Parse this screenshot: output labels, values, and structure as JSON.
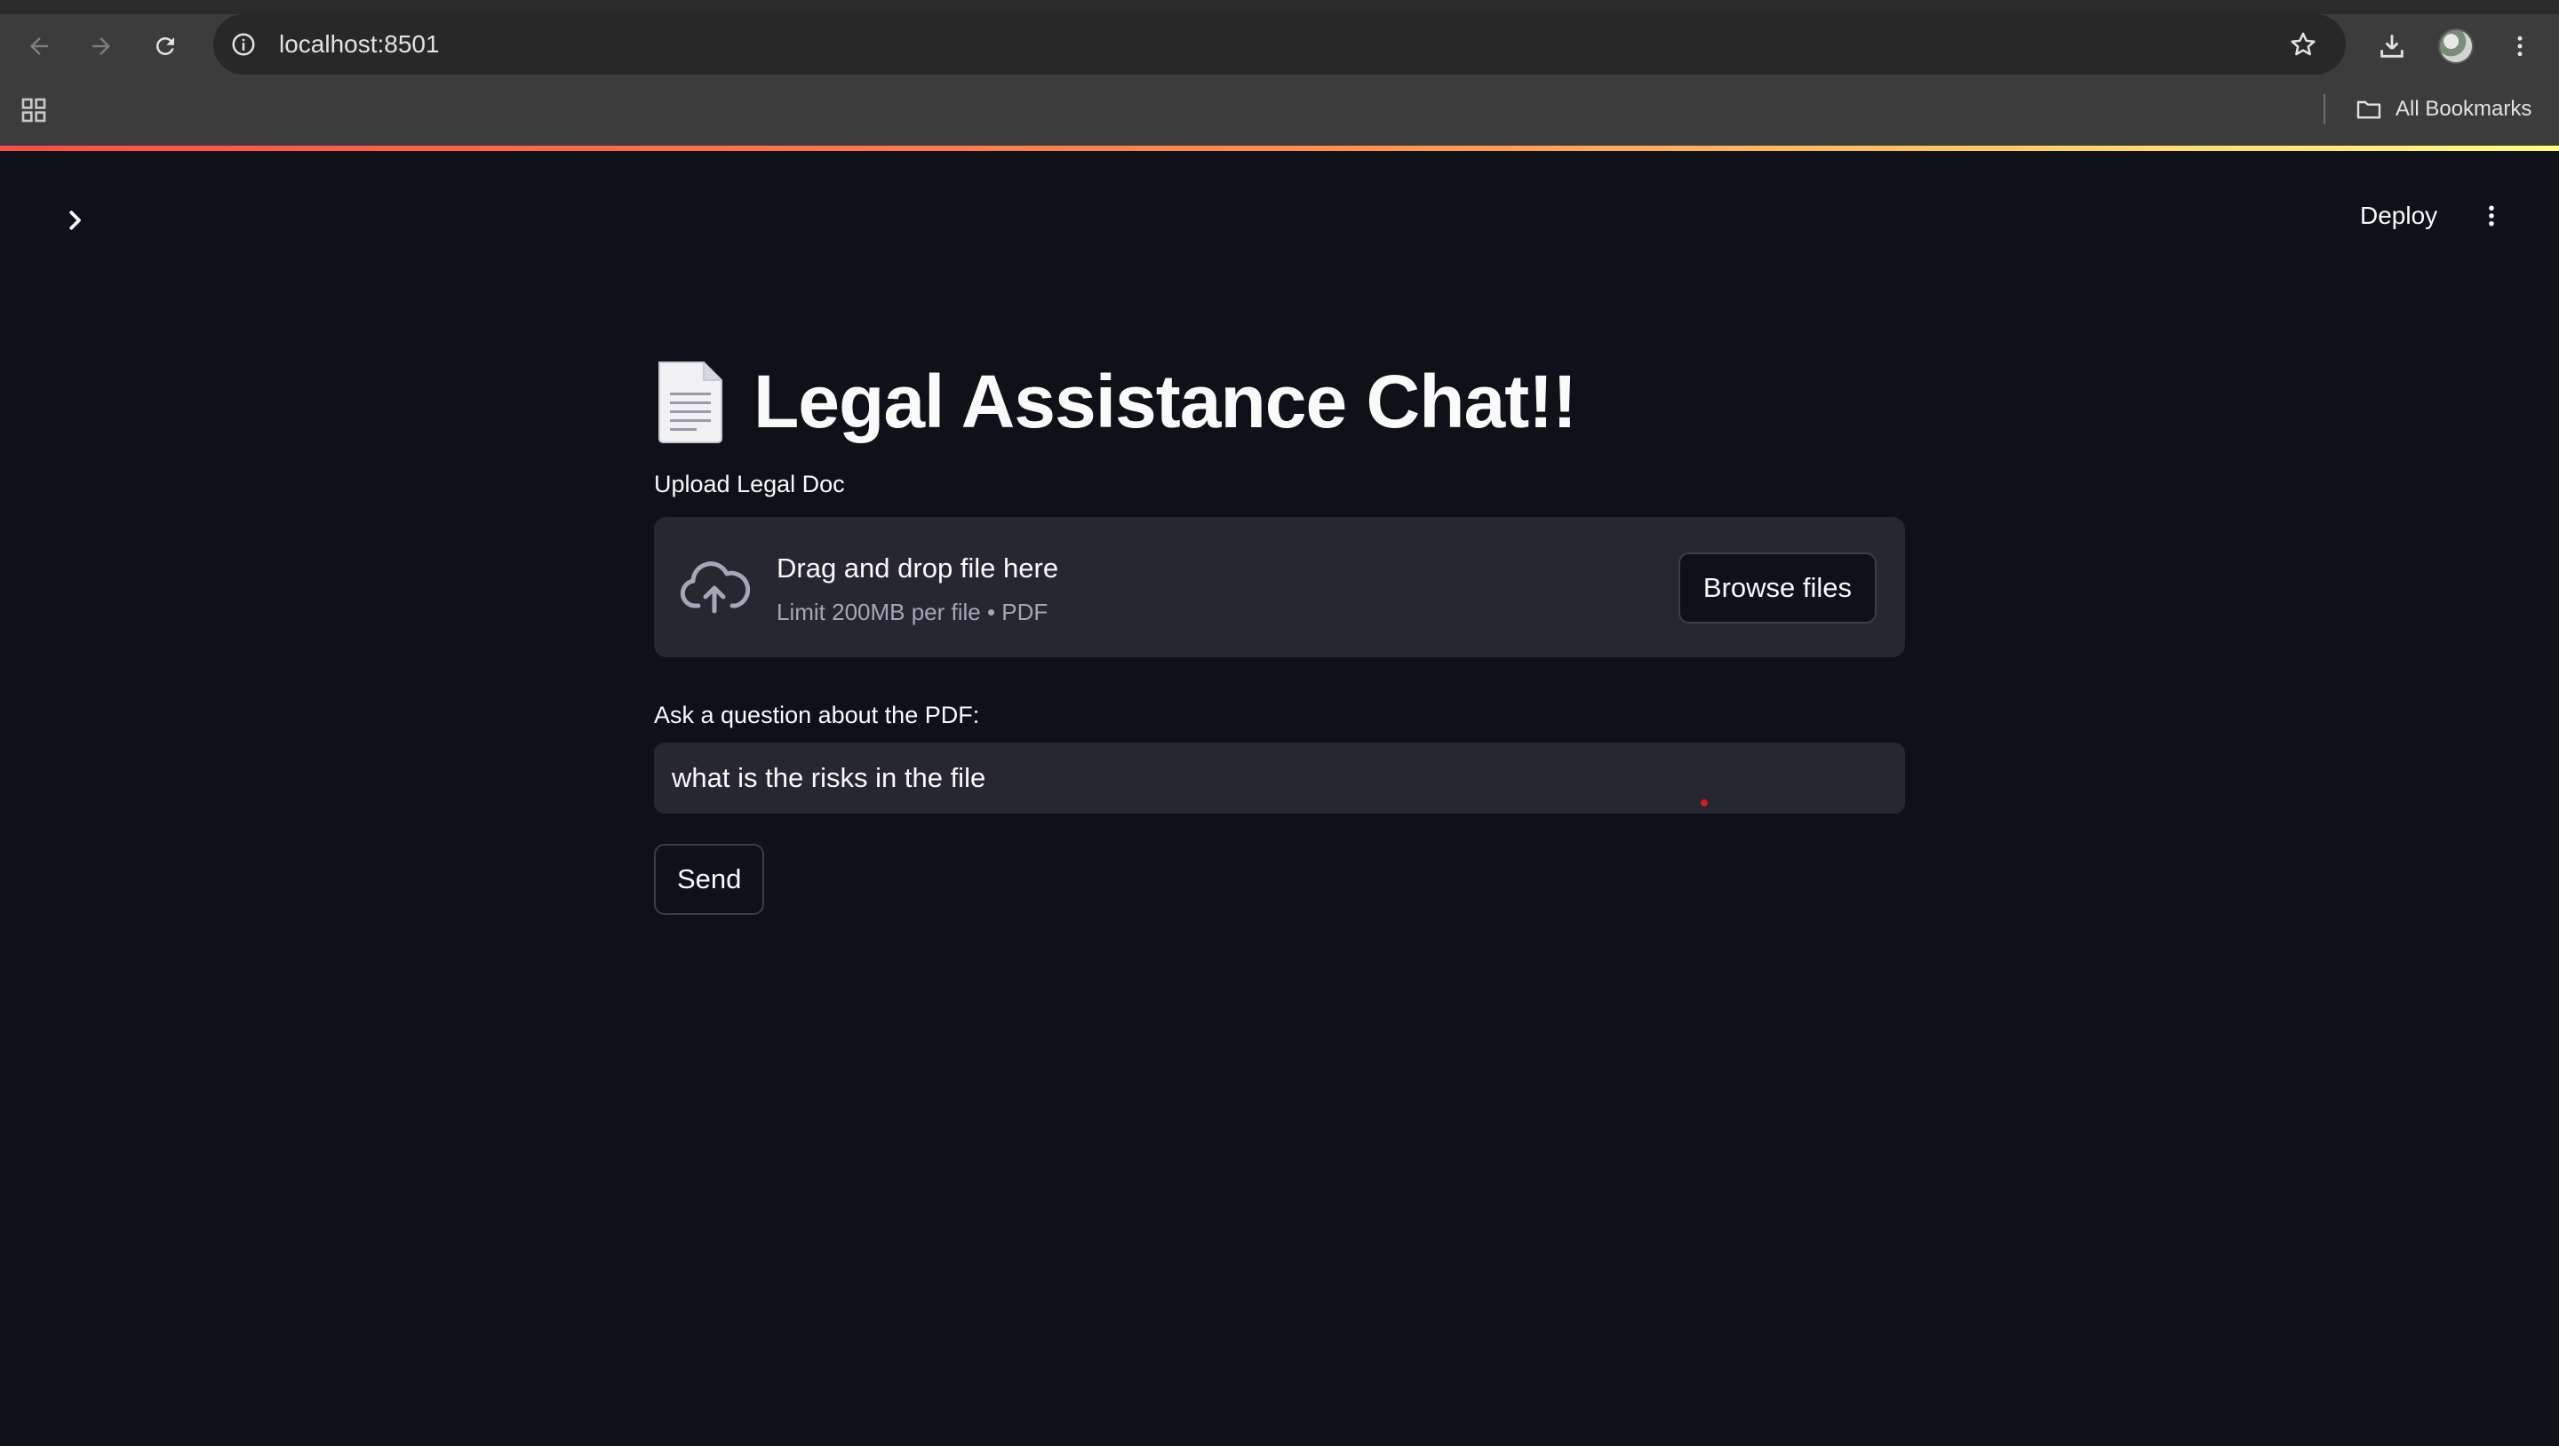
{
  "browser": {
    "url": "localhost:8501",
    "bookmarks_label": "All Bookmarks",
    "icons": [
      "back-icon",
      "forward-icon",
      "reload-icon",
      "site-info-icon",
      "star-icon",
      "download-icon",
      "profile-avatar",
      "kebab-menu-icon",
      "apps-grid-icon",
      "folder-icon"
    ]
  },
  "app": {
    "header": {
      "deploy_label": "Deploy"
    },
    "title": "Legal Assistance Chat!!",
    "title_icon": "page-facing-up-icon",
    "uploader": {
      "label": "Upload Legal Doc",
      "drop_text": "Drag and drop file here",
      "limit_text": "Limit 200MB per file • PDF",
      "browse_label": "Browse files"
    },
    "question": {
      "label": "Ask a question about the PDF:",
      "value": "what is the risks in the file"
    },
    "send_label": "Send"
  },
  "colors": {
    "background": "#0e1117",
    "widget_bg": "#262730",
    "text": "#fafafa",
    "muted_text": "#a3a8b8",
    "chrome_bg": "#3c3c3c",
    "accent_gradient_start": "#ff4b4b",
    "accent_gradient_end": "#fffd80"
  }
}
